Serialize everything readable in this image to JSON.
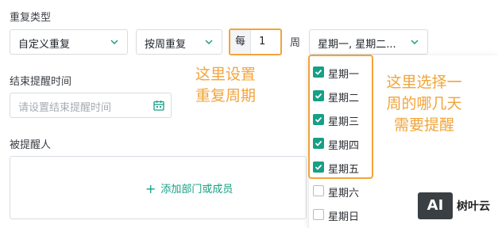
{
  "repeat_type": {
    "label": "重复类型",
    "mode_value": "自定义重复",
    "unit_value": "按周重复",
    "every_prefix": "每",
    "every_value": "1",
    "every_suffix": "周",
    "days_value": "星期一, 星期二..."
  },
  "annotations": {
    "left_line1": "这里设置",
    "left_line2": "重复周期",
    "right_line1": "这里选择一",
    "right_line2": "周的哪几天",
    "right_line3": "需要提醒"
  },
  "end_reminder": {
    "label": "结束提醒时间",
    "placeholder": "请设置结束提醒时间"
  },
  "reminded": {
    "label": "被提醒人",
    "add_label": "添加部门或成员"
  },
  "weekdays": [
    {
      "label": "星期一",
      "checked": true
    },
    {
      "label": "星期二",
      "checked": true
    },
    {
      "label": "星期三",
      "checked": true
    },
    {
      "label": "星期四",
      "checked": true
    },
    {
      "label": "星期五",
      "checked": true
    },
    {
      "label": "星期六",
      "checked": false
    },
    {
      "label": "星期日",
      "checked": false
    }
  ],
  "watermark": {
    "logo_text": "AI",
    "name": "树叶云"
  },
  "colors": {
    "accent": "#16a085",
    "annotation": "#f2a43a"
  }
}
